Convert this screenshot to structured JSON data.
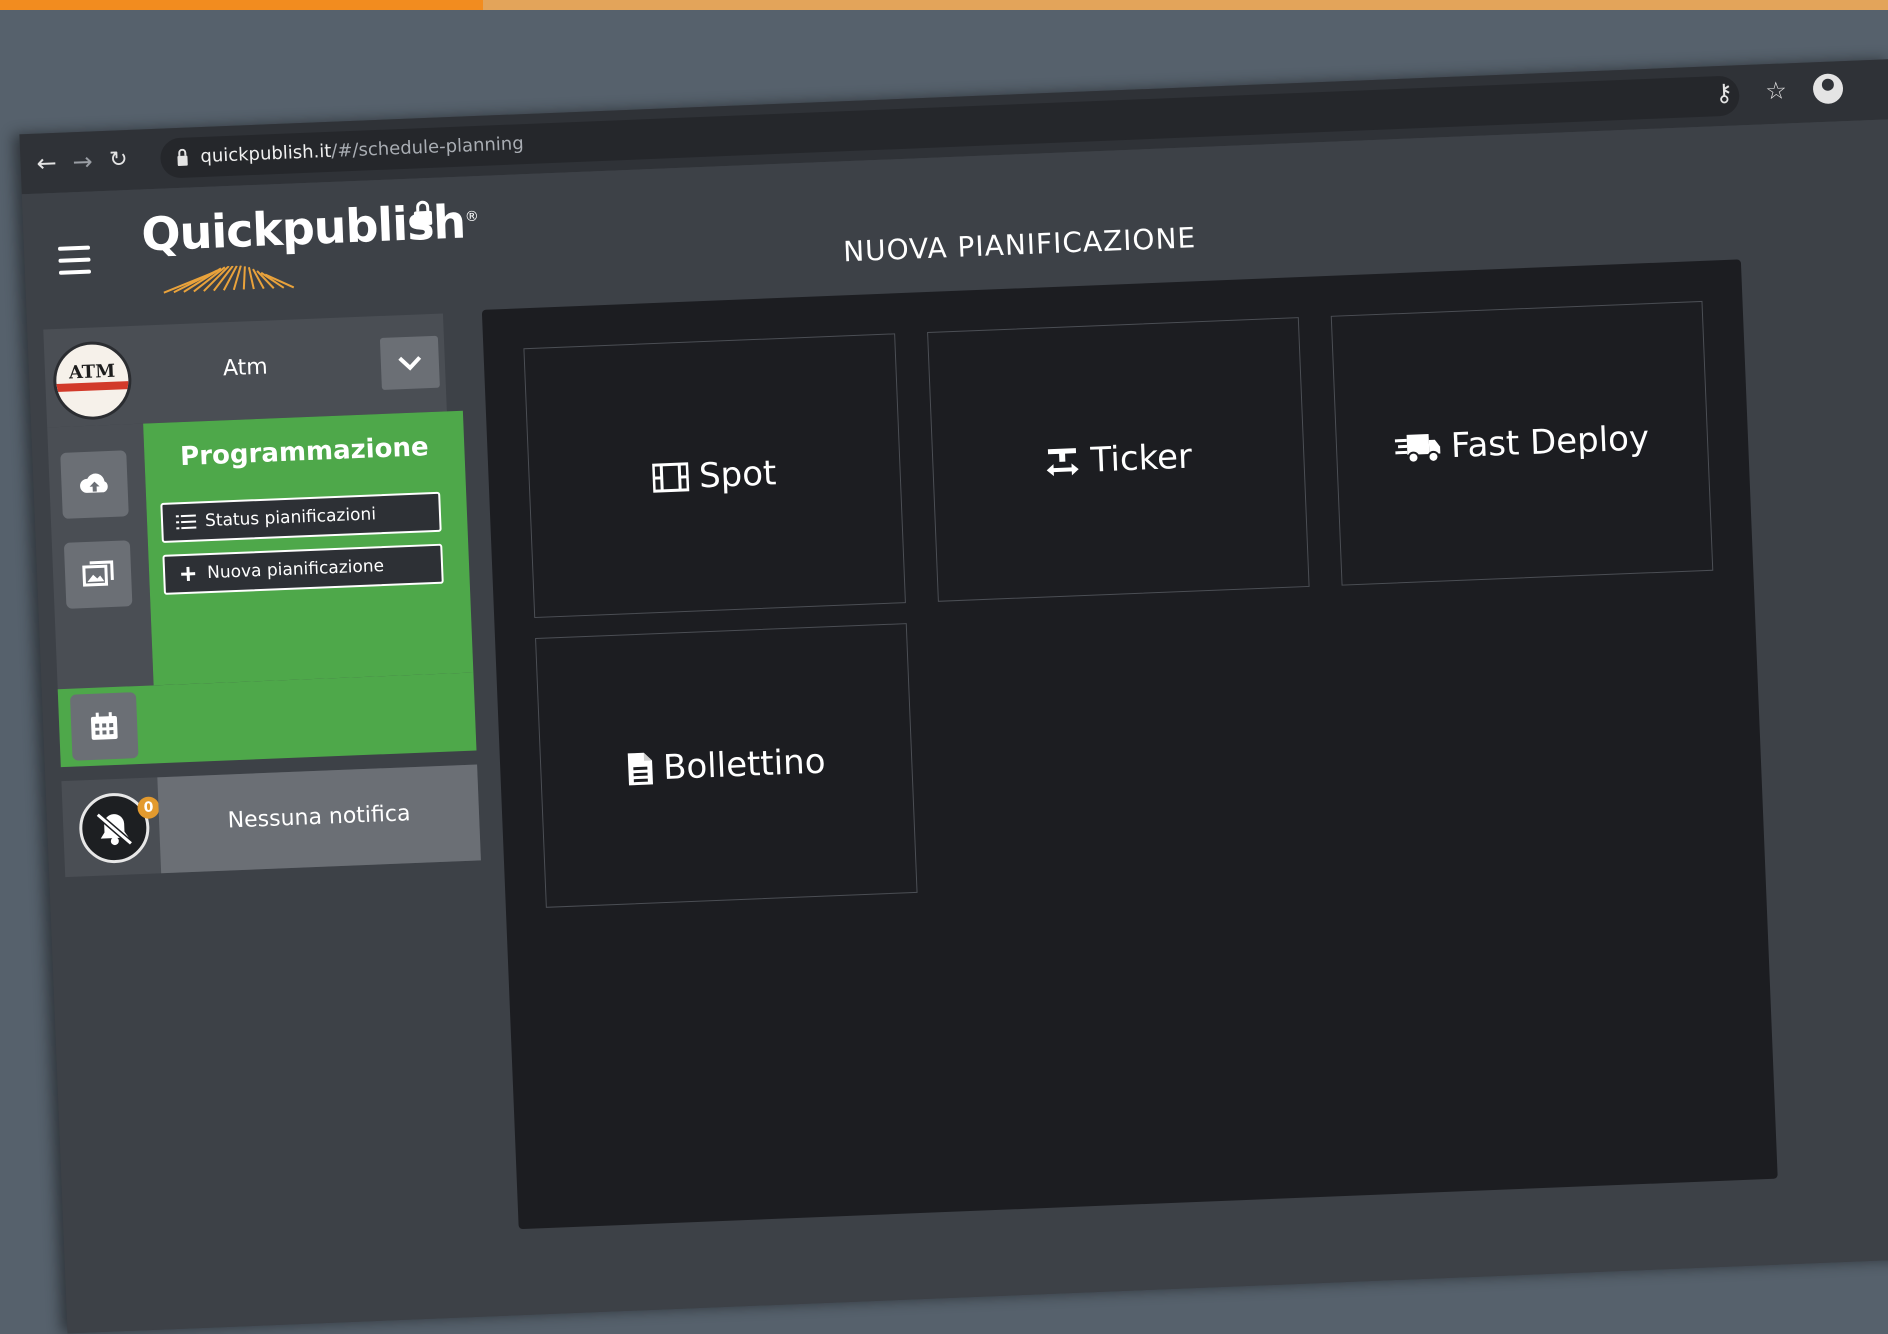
{
  "progress": {
    "fraction": 0.256
  },
  "browser": {
    "url_host": "quickpublish.it",
    "url_path": "/#/schedule-planning",
    "back_icon": "arrow-left-icon",
    "forward_icon": "arrow-right-icon",
    "reload_icon": "reload-icon",
    "key_icon": "key-icon",
    "star_icon": "star-icon",
    "profile_icon": "profile-icon"
  },
  "app": {
    "logo_text": "Quickpublish",
    "logo_mark": "®",
    "company": {
      "name": "Atm",
      "logo_text": "ATM"
    },
    "sidebar": {
      "section_title": "Programmazione",
      "items": [
        {
          "label": "Status pianificazioni",
          "icon": "list-icon"
        },
        {
          "label": "Nuova pianificazione",
          "icon": "plus-icon"
        }
      ],
      "rail": [
        "cloud-upload-icon",
        "images-icon",
        "calendar-icon"
      ]
    },
    "notifications": {
      "text": "Nessuna notifica",
      "count": "0"
    },
    "main": {
      "title": "NUOVA PIANIFICAZIONE",
      "tiles": [
        {
          "label": "Spot",
          "icon": "film-icon"
        },
        {
          "label": "Ticker",
          "icon": "text-width-icon"
        },
        {
          "label": "Fast Deploy",
          "icon": "shipping-fast-icon"
        },
        {
          "label": "Bollettino",
          "icon": "file-alt-icon"
        }
      ]
    }
  },
  "colors": {
    "accent_green": "#4ea84a",
    "progress_orange": "#f28c1f",
    "panel_dark": "#1c1d21",
    "sidebar_gray": "#4a4e54"
  }
}
